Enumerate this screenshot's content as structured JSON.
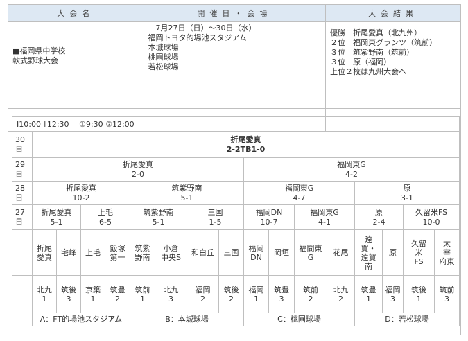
{
  "header": {
    "col_name": "大会名",
    "col_date_venue": "開催日・会場",
    "col_result": "大会結果"
  },
  "tournament": {
    "name_lines": [
      "■福岡県中学校",
      "軟式野球大会"
    ],
    "date_venue_lines": [
      "　7月27日（日）～30日（水）",
      "福岡トヨタ的場池スタジアム",
      "本城球場",
      "桃園球場",
      "若松球場"
    ],
    "result_lines": [
      "優勝　折尾愛真（北九州）",
      "２位　福岡東グランツ（筑前）",
      "３位　筑紫野南（筑前）",
      "３位　原（福岡）",
      "上位２校は九州大会へ"
    ]
  },
  "bracket": {
    "times": "Ⅰ10:00  Ⅱ12:30　 ①9:30 ②12:00",
    "day30": "30\n日",
    "day29": "29\n日",
    "day28": "28\n日",
    "day27": "27\n日",
    "final": {
      "team": "折尾愛真",
      "score": "2-2TB1-0"
    },
    "r29": [
      {
        "team": "折尾愛真",
        "score": "2-0"
      },
      {
        "team": "福岡東G",
        "score": "4-2"
      }
    ],
    "r28": [
      {
        "team": "折尾愛真",
        "score": "10-2"
      },
      {
        "team": "筑紫野南",
        "score": "5-1"
      },
      {
        "team": "福岡東G",
        "score": "4-7"
      },
      {
        "team": "原",
        "score": "3-1"
      }
    ],
    "r27": [
      {
        "team": "折尾愛真",
        "score": "5-1"
      },
      {
        "team": "上毛",
        "score": "6-5"
      },
      {
        "team": "筑紫野南",
        "score": "5-1"
      },
      {
        "team": "三国",
        "score": "1-5"
      },
      {
        "team": "福岡DN",
        "score": "10-7"
      },
      {
        "team": "福岡東G",
        "score": "4-1"
      },
      {
        "team": "原",
        "score": "2-4"
      },
      {
        "team": "久留米FS",
        "score": "10-0"
      }
    ],
    "teams": [
      "折尾\n愛真",
      "宅峰",
      "上毛",
      "飯塚\n第一",
      "筑紫\n野南",
      "小倉\n中央S",
      "和白丘",
      "三国",
      "福岡\nDN",
      "岡垣",
      "福間東\nG",
      "花尾",
      "遠\n賀・\n遠賀\n南",
      "原",
      "久留\n米\nFS",
      "太\n宰\n府東"
    ],
    "regions": [
      "北九\n1",
      "筑後\n3",
      "京築\n1",
      "筑豊\n2",
      "筑前\n1",
      "北九\n3",
      "福岡\n2",
      "筑後\n2",
      "福岡\n1",
      "筑豊\n3",
      "筑前\n2",
      "北九\n2",
      "筑豊\n1",
      "福岡\n3",
      "筑後\n1",
      "筑前\n3"
    ],
    "venues": [
      "A：FT的場池スタジアム",
      "B：本城球場",
      "C：桃園球場",
      "D：若松球場"
    ]
  }
}
